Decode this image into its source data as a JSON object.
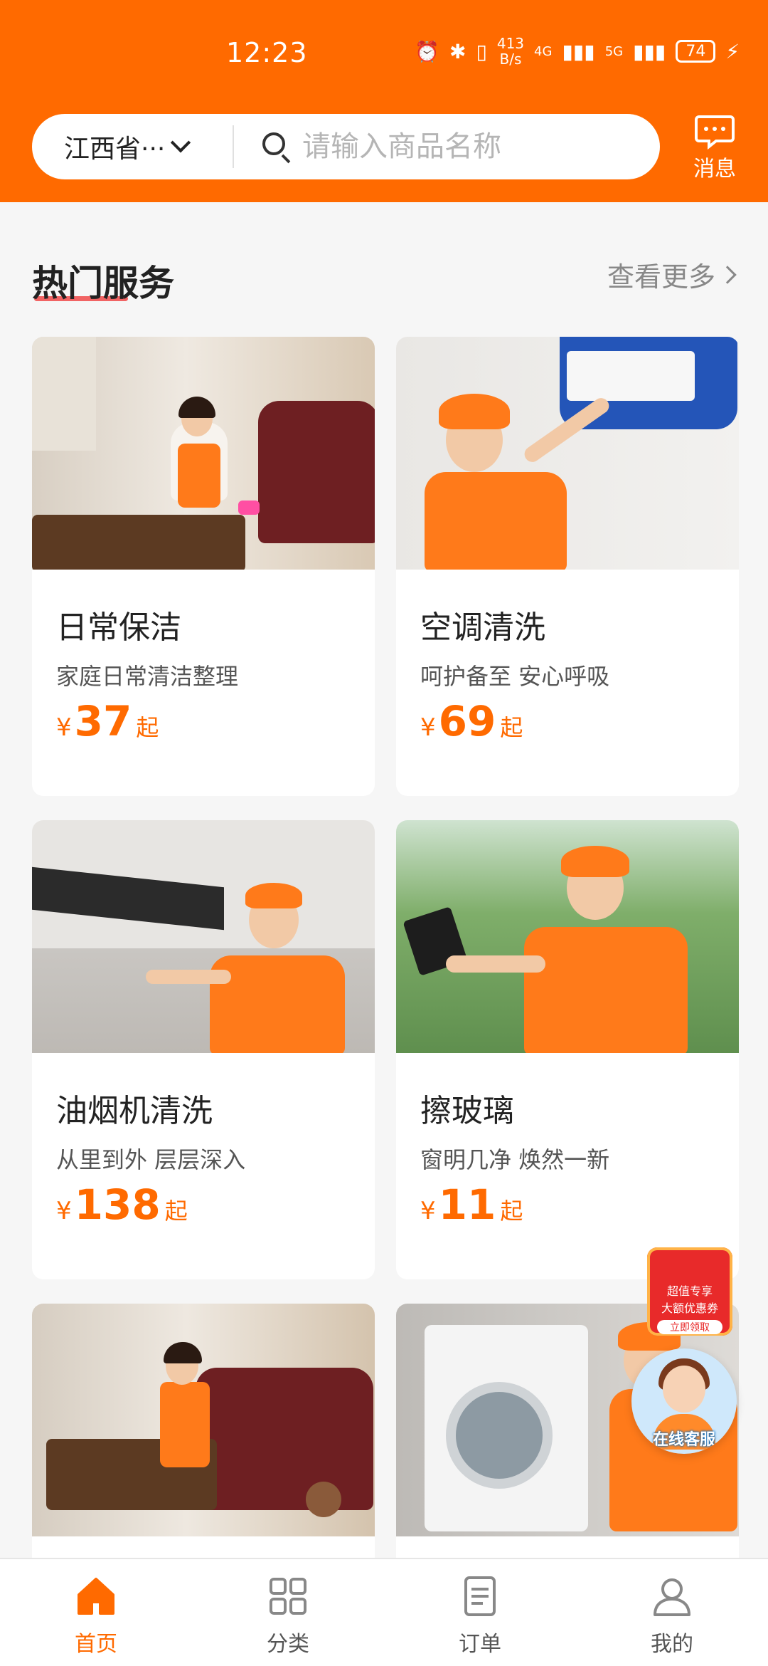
{
  "status_bar": {
    "time": "12:23",
    "net_speed_value": "413",
    "net_speed_unit": "B/s",
    "network_1": "4G",
    "network_2": "5G",
    "battery": "74"
  },
  "header": {
    "region": "江西省···",
    "search_placeholder": "请输入商品名称",
    "messages_label": "消息"
  },
  "section": {
    "title": "热门服务",
    "more_label": "查看更多"
  },
  "services": [
    {
      "title": "日常保洁",
      "desc": "家庭日常清洁整理",
      "currency": "¥",
      "price": "37",
      "suffix": "起"
    },
    {
      "title": "空调清洗",
      "desc": "呵护备至 安心呼吸",
      "currency": "¥",
      "price": "69",
      "suffix": "起"
    },
    {
      "title": "油烟机清洗",
      "desc": "从里到外 层层深入",
      "currency": "¥",
      "price": "138",
      "suffix": "起"
    },
    {
      "title": "擦玻璃",
      "desc": "窗明几净 焕然一新",
      "currency": "¥",
      "price": "11",
      "suffix": "起"
    },
    {
      "title": "",
      "desc": "",
      "currency": "",
      "price": "",
      "suffix": ""
    },
    {
      "title": "",
      "desc": "",
      "currency": "",
      "price": "",
      "suffix": ""
    }
  ],
  "floating": {
    "coupon_line1": "超值专享",
    "coupon_line2": "大额优惠券",
    "coupon_button": "立即领取",
    "online_service": "在线客服"
  },
  "tabbar": [
    {
      "label": "首页",
      "icon": "home-icon",
      "active": true
    },
    {
      "label": "分类",
      "icon": "grid-icon",
      "active": false
    },
    {
      "label": "订单",
      "icon": "document-icon",
      "active": false
    },
    {
      "label": "我的",
      "icon": "user-icon",
      "active": false
    }
  ],
  "colors": {
    "brand": "#ff6a00",
    "background": "#f6f6f6",
    "accent_underline": "#f04a4a"
  }
}
